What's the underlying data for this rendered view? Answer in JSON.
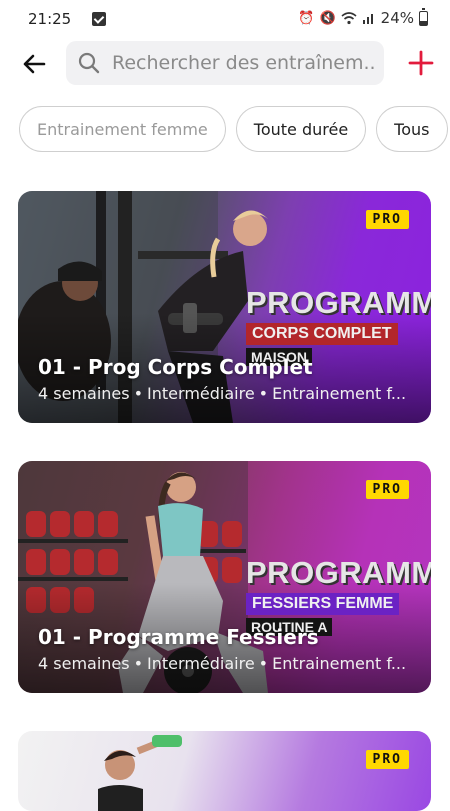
{
  "status_bar": {
    "time": "21:25",
    "battery": "24%",
    "battery_level": 0.24,
    "icons": [
      "checkbox-notification-icon",
      "alarm-icon",
      "mute-icon",
      "wifi-icon",
      "signal-icon",
      "battery-icon"
    ]
  },
  "header": {
    "search_placeholder": "Rechercher des entraînem...",
    "back_icon": "arrow-left-icon",
    "add_icon": "plus-icon",
    "accent_color": "#e21b3c"
  },
  "filters": {
    "chips": [
      {
        "label": "Entrainement femme",
        "state": "faded"
      },
      {
        "label": "Toute durée"
      },
      {
        "label": "Tous"
      }
    ]
  },
  "programs": [
    {
      "badge": "PRO",
      "title": "01 - Prog Corps Complet",
      "duration": "4 semaines",
      "level": "Intermédiaire",
      "category": "Entrainement f...",
      "banner_title": "PROGRAMME",
      "banner_subtitle": "CORPS COMPLET",
      "banner_tag": "MAISON"
    },
    {
      "badge": "PRO",
      "title": "01 - Programme Fessiers",
      "duration": "4 semaines",
      "level": "Intermédiaire",
      "category": "Entrainement f...",
      "banner_title": "PROGRAMME",
      "banner_subtitle": "FESSIERS FEMME",
      "banner_tag": "ROUTINE A"
    },
    {
      "badge": "PRO"
    }
  ],
  "colors": {
    "pro_badge": "#ffd800",
    "card1_accent": "#8a28d9",
    "card2_accent": "#b532b8"
  }
}
